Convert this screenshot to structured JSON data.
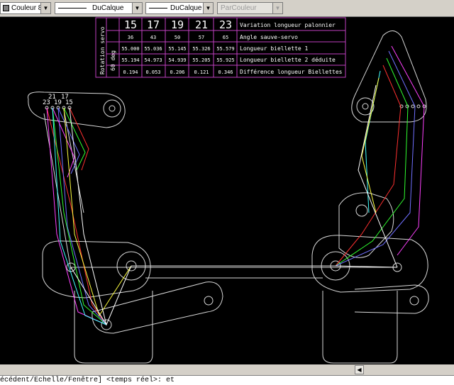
{
  "toolbar": {
    "color_combo": "Couleur 8",
    "linetype_combo": "DuCalque",
    "lineweight_combo": "DuCalque",
    "plotstyle_combo": "ParCouleur"
  },
  "table": {
    "side_label_1": "Rotation servo",
    "side_label_2": "60 deg",
    "header": [
      "15",
      "17",
      "19",
      "21",
      "23"
    ],
    "rows": [
      {
        "cells": [
          "36",
          "43",
          "50",
          "57",
          "65"
        ],
        "label": "Angle sauve-servo"
      },
      {
        "cells": [
          "55.000",
          "55.036",
          "55.145",
          "55.326",
          "55.579"
        ],
        "label": "Longueur biellette 1"
      },
      {
        "cells": [
          "55.194",
          "54.973",
          "54.939",
          "55.205",
          "55.925"
        ],
        "label": "Longueur biellette 2 déduite"
      },
      {
        "cells": [
          "0.194",
          "0.053",
          "0.206",
          "0.121",
          "0.346"
        ],
        "label": "Différence longueur Biellettes"
      }
    ],
    "header_label": "Variation longueur palonnier"
  },
  "drawing": {
    "hole_labels_top": [
      "21",
      "17"
    ],
    "hole_labels_bottom": [
      "23",
      "19",
      "15"
    ],
    "link_colors": [
      "#ff3030",
      "#30ff30",
      "#7070ff",
      "#ff40ff",
      "#40ffff",
      "#ffff40",
      "#ffffff"
    ]
  },
  "command_line": "écédent/Echelle/Fenêtre] <temps réel>: et"
}
